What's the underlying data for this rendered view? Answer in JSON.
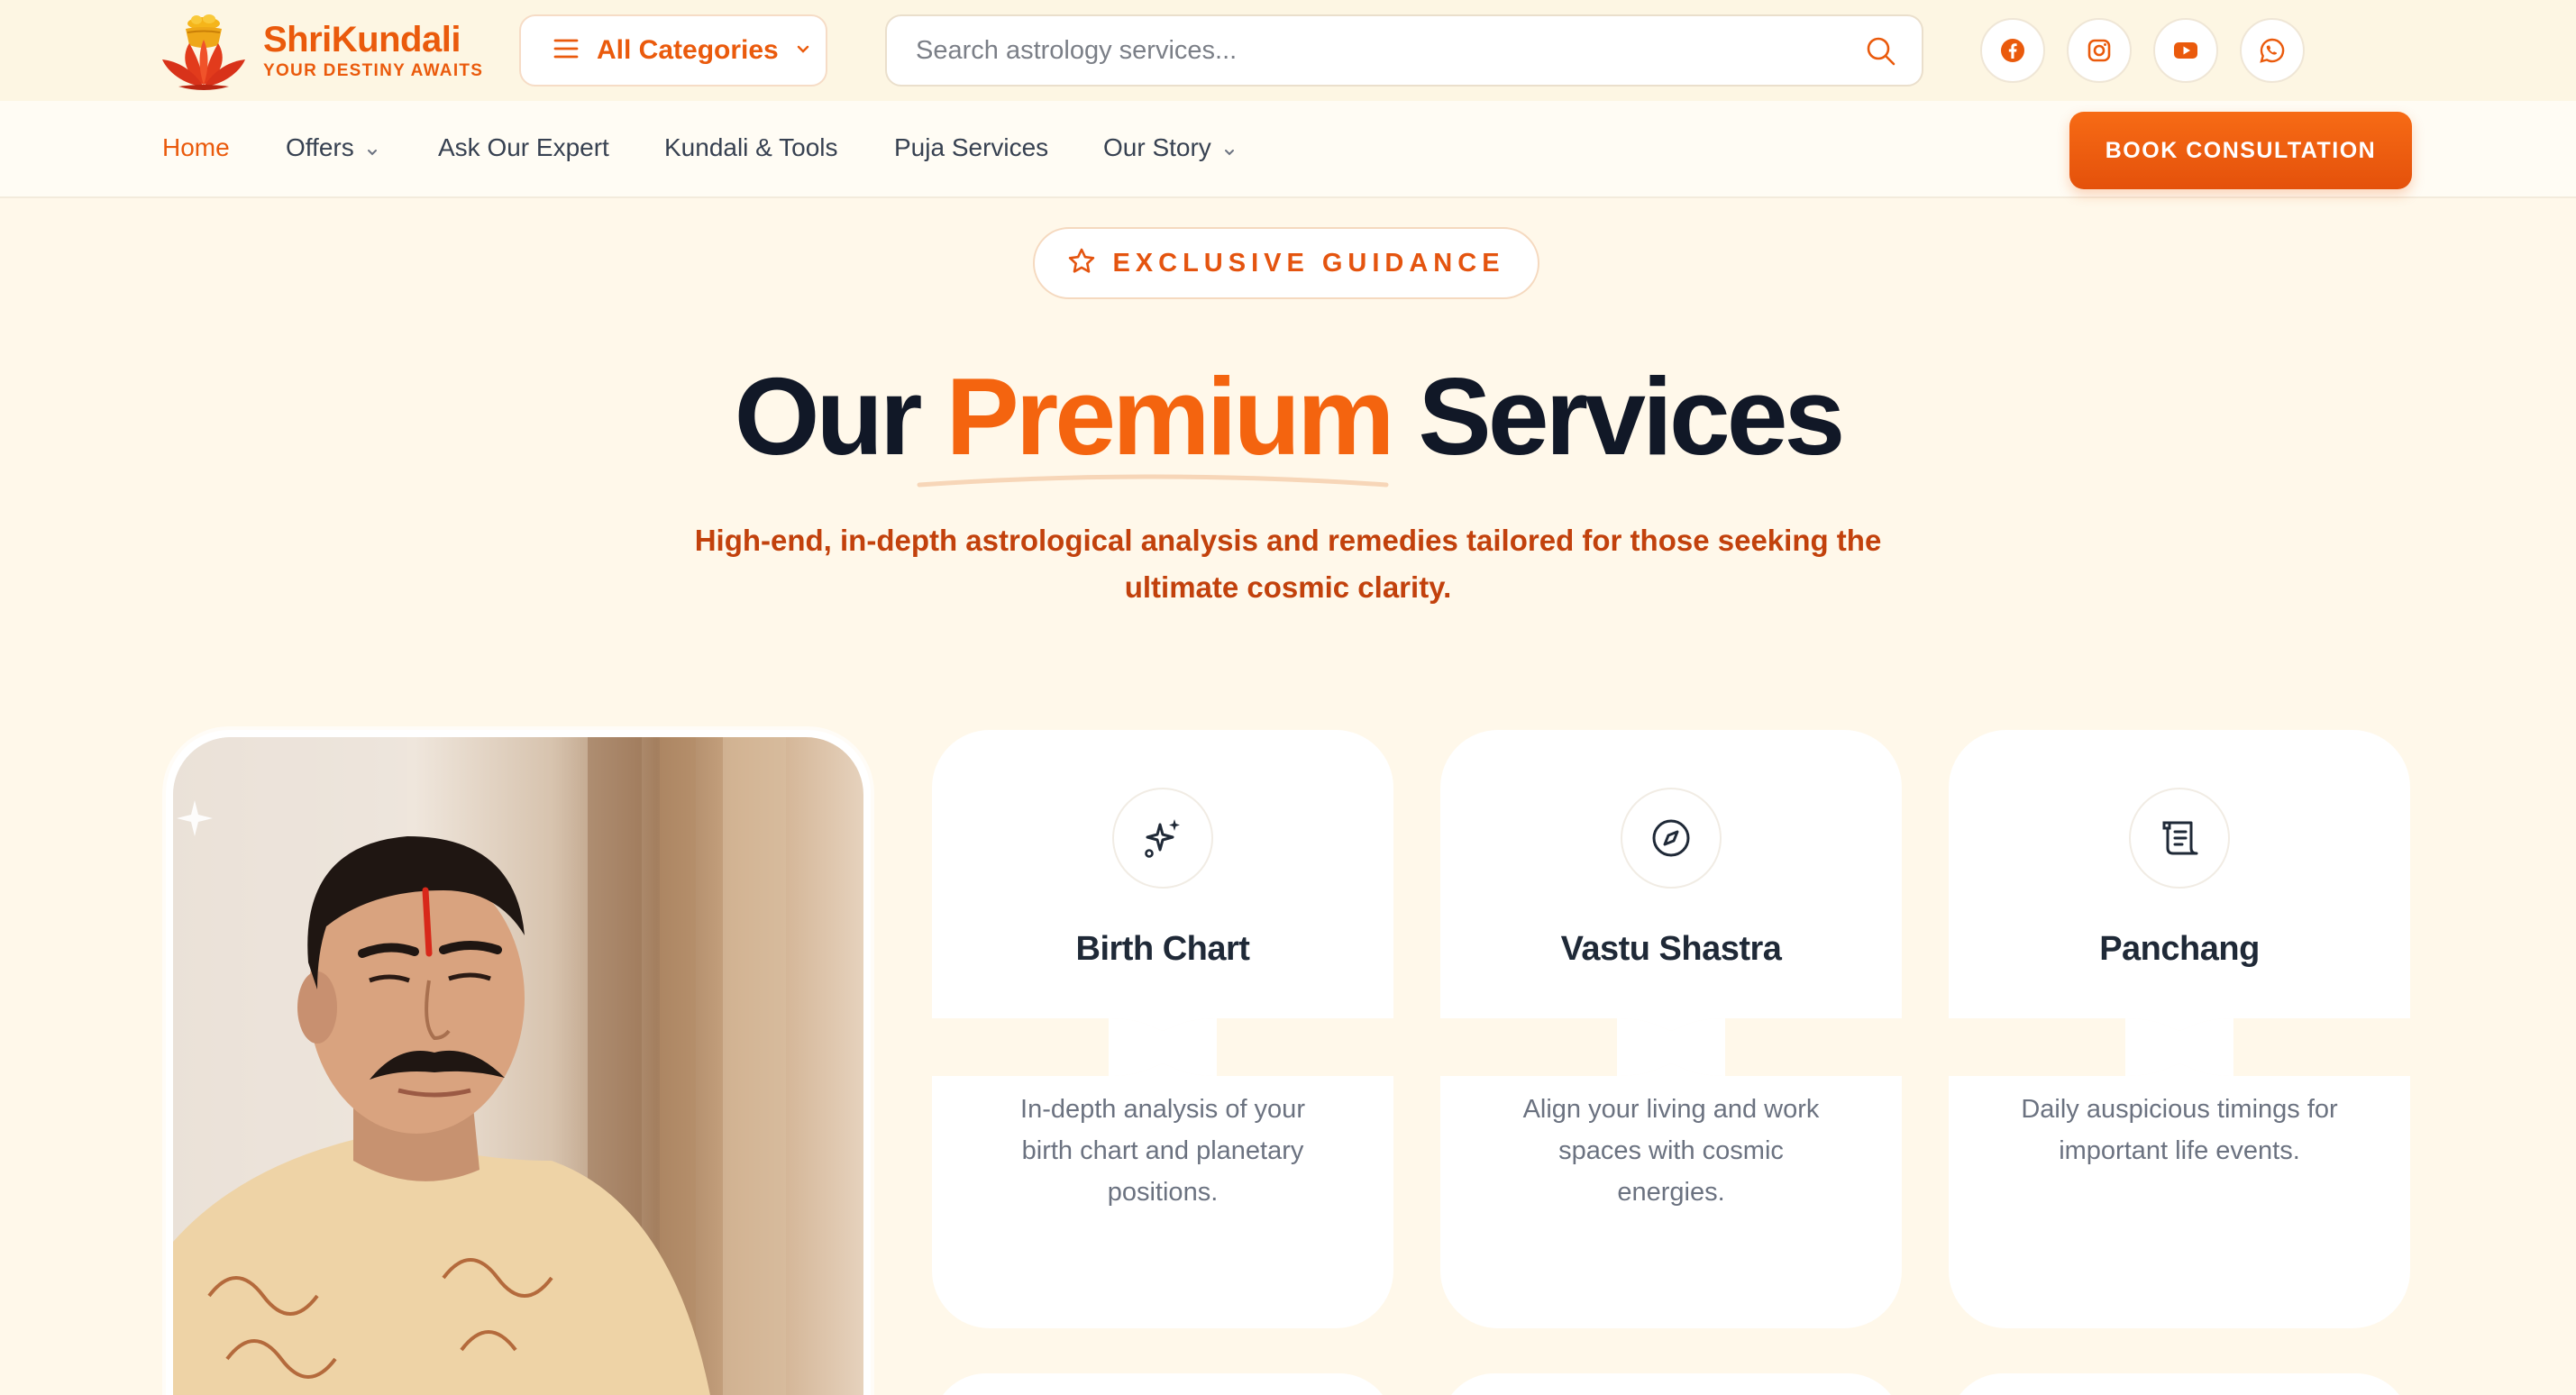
{
  "brand": {
    "name": "ShriKundali",
    "tagline": "YOUR DESTINY AWAITS"
  },
  "header": {
    "categories_label": "All Categories",
    "search_placeholder": "Search astrology services...",
    "social": [
      "facebook-icon",
      "instagram-icon",
      "youtube-icon",
      "whatsapp-icon"
    ]
  },
  "nav": {
    "items": [
      {
        "label": "Home",
        "active": true,
        "has_dropdown": false
      },
      {
        "label": "Offers",
        "active": false,
        "has_dropdown": true
      },
      {
        "label": "Ask Our Expert",
        "active": false,
        "has_dropdown": false
      },
      {
        "label": "Kundali & Tools",
        "active": false,
        "has_dropdown": false
      },
      {
        "label": "Puja Services",
        "active": false,
        "has_dropdown": false
      },
      {
        "label": "Our Story",
        "active": false,
        "has_dropdown": true
      }
    ],
    "cta_label": "BOOK CONSULTATION"
  },
  "hero": {
    "badge": "EXCLUSIVE GUIDANCE",
    "title_part1": "Our",
    "title_highlight": "Premium",
    "title_part2": "Services",
    "subtitle": "High-end, in-depth astrological analysis and remedies tailored for those seeking the ultimate cosmic clarity."
  },
  "services": [
    {
      "icon": "sparkles-icon",
      "title": "Birth Chart",
      "description": "In-depth analysis of your birth chart and planetary positions."
    },
    {
      "icon": "compass-icon",
      "title": "Vastu Shastra",
      "description": "Align your living and work spaces with cosmic energies."
    },
    {
      "icon": "scroll-icon",
      "title": "Panchang",
      "description": "Daily auspicious timings for important life events."
    }
  ],
  "colors": {
    "accent": "#ea5a0c",
    "background": "#fff8ea",
    "heading": "#111827",
    "subtitle": "#c2410c"
  }
}
